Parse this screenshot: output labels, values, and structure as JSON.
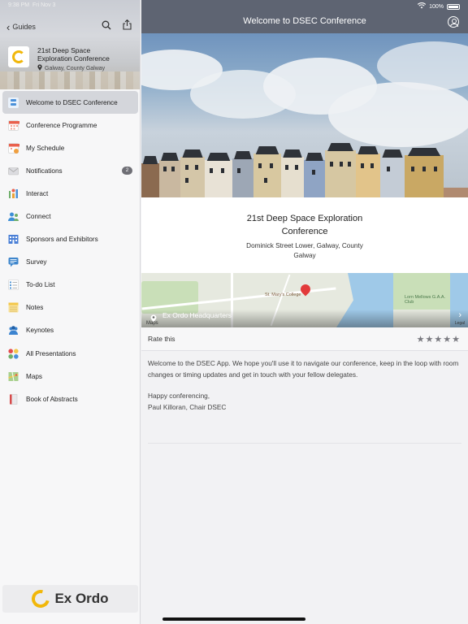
{
  "status": {
    "time": "9:38 PM",
    "date": "Fri Nov 3",
    "battery": "100%"
  },
  "sidebar": {
    "back_label": "Guides",
    "guide": {
      "title": "21st Deep Space Exploration Conference",
      "location": "Galway, County Galway"
    },
    "items": [
      {
        "label": "Welcome to DSEC Conference",
        "icon": "welcome-icon",
        "color": "#4a90d9",
        "active": true
      },
      {
        "label": "Conference Programme",
        "icon": "calendar-icon",
        "color": "#e9604c"
      },
      {
        "label": "My Schedule",
        "icon": "schedule-icon",
        "color": "#f08a5d"
      },
      {
        "label": "Notifications",
        "icon": "envelope-icon",
        "color": "#d8d8dc",
        "badge": "2"
      },
      {
        "label": "Interact",
        "icon": "interact-icon",
        "color": "#6fae6a"
      },
      {
        "label": "Connect",
        "icon": "connect-icon",
        "color": "#3d8fd6"
      },
      {
        "label": "Sponsors and Exhibitors",
        "icon": "building-icon",
        "color": "#4a7fd6"
      },
      {
        "label": "Survey",
        "icon": "chat-icon",
        "color": "#3e86cc"
      },
      {
        "label": "To-do List",
        "icon": "checklist-icon",
        "color": "#5a9ad6"
      },
      {
        "label": "Notes",
        "icon": "notes-icon",
        "color": "#f3c74b"
      },
      {
        "label": "Keynotes",
        "icon": "people-icon",
        "color": "#3c84d0"
      },
      {
        "label": "All Presentations",
        "icon": "dots-icon",
        "color": "#e44d4d"
      },
      {
        "label": "Maps",
        "icon": "map-icon",
        "color": "#6aa86a"
      },
      {
        "label": "Book of Abstracts",
        "icon": "book-icon",
        "color": "#d64a4a"
      }
    ],
    "footer_brand": "Ex Ordo"
  },
  "main": {
    "nav_title": "Welcome to DSEC Conference",
    "conference": {
      "title": "21st Deep Space Exploration Conference",
      "address": "Dominick Street Lower, Galway, County Galway"
    },
    "map": {
      "location_label": "Ex Ordo Headquarters",
      "poi_1": "St. Mary's College",
      "poi_2": "Lorn Mellows G.A.A. Club",
      "maps_label": "Maps",
      "legal": "Legal"
    },
    "rate_label": "Rate this",
    "rating_stars": 5,
    "body": {
      "p1": "Welcome to the DSEC App. We hope you'll use it to navigate our conference, keep in the loop with room changes or timing updates and get in touch with your fellow delegates.",
      "p2_line1": "Happy conferencing,",
      "p2_line2": "Paul Killoran, Chair DSEC"
    }
  }
}
